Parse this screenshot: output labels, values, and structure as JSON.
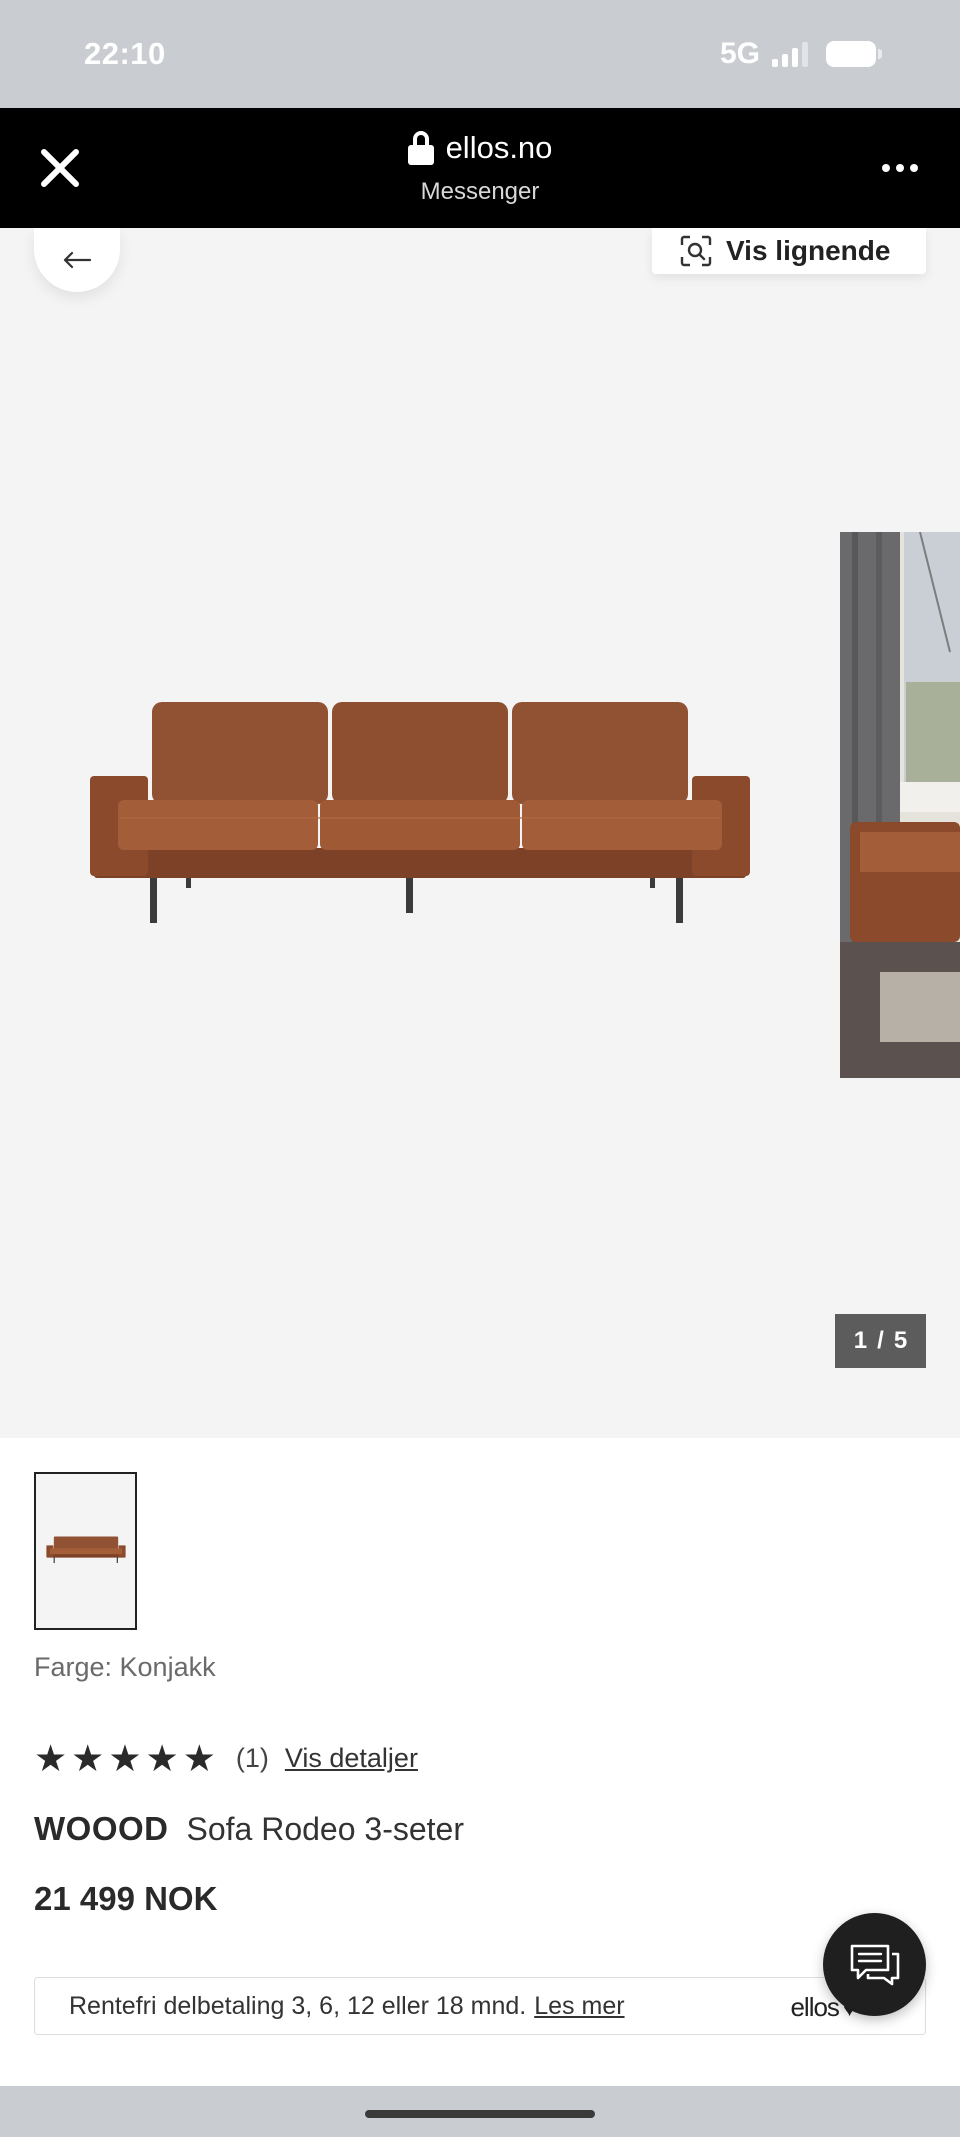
{
  "status_bar": {
    "time": "22:10",
    "network": "5G",
    "signal_bars": 4,
    "signal_active_bars": 3
  },
  "browser": {
    "domain": "ellos.no",
    "subtitle": "Messenger",
    "icons": {
      "close": "close-icon",
      "lock": "lock-icon",
      "more": "more-icon"
    }
  },
  "gallery": {
    "similar_label": "Vis lignende",
    "counter_current": "1",
    "counter_separator": "/",
    "counter_total": "5",
    "icons": {
      "back": "arrow-left-icon",
      "similar": "visual-search-icon"
    }
  },
  "product": {
    "color_line": "Farge: Konjakk",
    "rating_stars": 5,
    "rating_count": "(1)",
    "details_link": "Vis detaljer",
    "brand": "WOOOD",
    "name": "Sofa Rodeo 3-seter",
    "price": "21 499 NOK"
  },
  "finance": {
    "text": "Rentefri delbetaling 3, 6, 12 eller 18 mnd.",
    "link": "Les mer",
    "logo": "ellos"
  },
  "chat": {
    "icon": "chat-icon"
  },
  "colors": {
    "sofa": "#8a4a2b",
    "sofa_highlight": "#a45d39",
    "browser_bar": "#000000",
    "gallery_bg": "#f4f4f4",
    "counter_bg": "#5c5c5c",
    "status_bg": "#c9ccd1"
  }
}
